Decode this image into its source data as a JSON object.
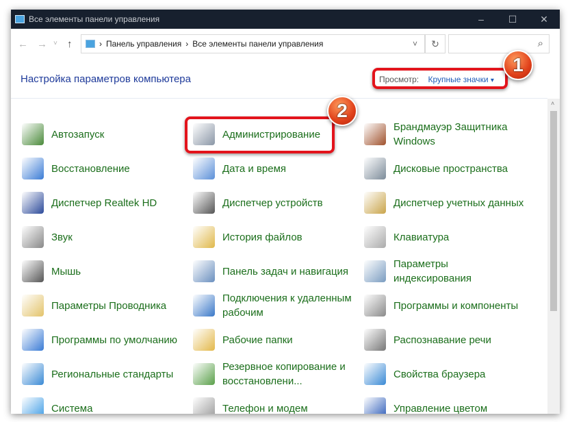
{
  "window": {
    "title": "Все элементы панели управления",
    "minimize": "–",
    "maximize": "☐",
    "close": "✕"
  },
  "nav": {
    "back": "←",
    "forward": "→",
    "recent": "˅",
    "up": "↑",
    "breadcrumb": [
      "Панель управления",
      "Все элементы панели управления"
    ],
    "sep": "›",
    "dropdown": "˅",
    "refresh": "↻",
    "search_icon": "⌕",
    "search_placeholder": ""
  },
  "heading": "Настройка параметров компьютера",
  "view": {
    "label": "Просмотр:",
    "value": "Крупные значки",
    "arrow": "▾"
  },
  "items": [
    [
      "Автозапуск",
      "Администрирование",
      "Брандмауэр Защитника Windows"
    ],
    [
      "Восстановление",
      "Дата и время",
      "Дисковые пространства"
    ],
    [
      "Диспетчер Realtek HD",
      "Диспетчер устройств",
      "Диспетчер учетных данных"
    ],
    [
      "Звук",
      "История файлов",
      "Клавиатура"
    ],
    [
      "Мышь",
      "Панель задач и навигация",
      "Параметры индексирования"
    ],
    [
      "Параметры Проводника",
      "Подключения к удаленным рабочим",
      "Программы и компоненты"
    ],
    [
      "Программы по умолчанию",
      "Рабочие папки",
      "Распознавание речи"
    ],
    [
      "Региональные стандарты",
      "Резервное копирование и восстановлени...",
      "Свойства браузера"
    ],
    [
      "Система",
      "Телефон и модем",
      "Управление цветом"
    ]
  ],
  "icon_colors": [
    [
      "#4a8a3a",
      "#8a96a6",
      "#a0522d"
    ],
    [
      "#3a7bd5",
      "#5b8fd8",
      "#7c8b99"
    ],
    [
      "#2c4a9a",
      "#555",
      "#c9a44a"
    ],
    [
      "#888",
      "#e0b84a",
      "#aaa"
    ],
    [
      "#555",
      "#6a8fbf",
      "#7a9cc0"
    ],
    [
      "#e3c36a",
      "#3a78c8",
      "#8a8a8a"
    ],
    [
      "#3a7bd5",
      "#e3b84a",
      "#777"
    ],
    [
      "#3a8ad5",
      "#5aa04a",
      "#3a8ad5"
    ],
    [
      "#3a9ae5",
      "#999",
      "#2a5ab8"
    ]
  ],
  "annotations": {
    "badge1": "1",
    "badge2": "2",
    "color": "#e3141c"
  }
}
